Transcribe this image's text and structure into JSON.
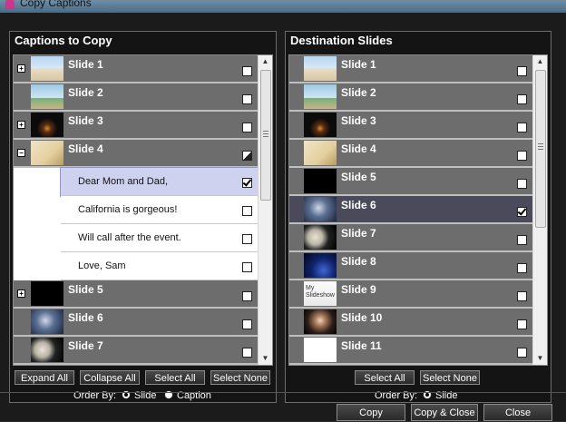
{
  "window": {
    "title": "Copy Captions"
  },
  "left": {
    "title": "Captions to Copy",
    "rows": [
      {
        "type": "slide",
        "label": "Slide 1",
        "thumb": "beach",
        "expander": "+",
        "checkbox": "unchecked"
      },
      {
        "type": "slide",
        "label": "Slide 2",
        "thumb": "palm",
        "expander": "",
        "checkbox": "unchecked"
      },
      {
        "type": "slide",
        "label": "Slide 3",
        "thumb": "night-road",
        "expander": "+",
        "checkbox": "unchecked"
      },
      {
        "type": "slide",
        "label": "Slide 4",
        "thumb": "letter",
        "expander": "−",
        "checkbox": "partial"
      },
      {
        "type": "caption",
        "label": "Dear Mom and Dad,",
        "checkbox": "checked",
        "selected": true
      },
      {
        "type": "caption",
        "label": "California is gorgeous!",
        "checkbox": "unchecked"
      },
      {
        "type": "caption",
        "label": "Will call after the event.",
        "checkbox": "unchecked"
      },
      {
        "type": "caption",
        "label": "Love, Sam",
        "checkbox": "unchecked"
      },
      {
        "type": "slide",
        "label": "Slide 5",
        "thumb": "black",
        "expander": "+",
        "checkbox": "unchecked"
      },
      {
        "type": "slide",
        "label": "Slide 6",
        "thumb": "blue-photo",
        "expander": "",
        "checkbox": "unchecked"
      },
      {
        "type": "slide",
        "label": "Slide 7",
        "thumb": "moon",
        "expander": "",
        "checkbox": "unchecked"
      }
    ],
    "buttons": {
      "expand_all": "Expand All",
      "collapse_all": "Collapse All",
      "select_all": "Select All",
      "select_none": "Select None"
    },
    "order": {
      "label": "Order By:",
      "options": [
        "Slide",
        "Caption"
      ],
      "selected": "Slide"
    }
  },
  "right": {
    "title": "Destination Slides",
    "rows": [
      {
        "type": "slide",
        "label": "Slide 1",
        "thumb": "beach",
        "checkbox": "unchecked"
      },
      {
        "type": "slide",
        "label": "Slide 2",
        "thumb": "palm",
        "checkbox": "unchecked"
      },
      {
        "type": "slide",
        "label": "Slide 3",
        "thumb": "night-road",
        "checkbox": "unchecked"
      },
      {
        "type": "slide",
        "label": "Slide 4",
        "thumb": "letter",
        "checkbox": "unchecked"
      },
      {
        "type": "slide",
        "label": "Slide 5",
        "thumb": "black",
        "checkbox": "unchecked"
      },
      {
        "type": "slide",
        "label": "Slide 6",
        "thumb": "blue-photo",
        "checkbox": "checked",
        "selected": true
      },
      {
        "type": "slide",
        "label": "Slide 7",
        "thumb": "moon",
        "checkbox": "unchecked"
      },
      {
        "type": "slide",
        "label": "Slide 8",
        "thumb": "blue-night",
        "checkbox": "unchecked"
      },
      {
        "type": "slide",
        "label": "Slide 9",
        "thumb": "myslideshow",
        "thumb_text": "My Slideshow",
        "checkbox": "unchecked"
      },
      {
        "type": "slide",
        "label": "Slide 10",
        "thumb": "person",
        "checkbox": "unchecked"
      },
      {
        "type": "slide",
        "label": "Slide 11",
        "thumb": "white",
        "checkbox": "unchecked"
      }
    ],
    "buttons": {
      "select_all": "Select All",
      "select_none": "Select None"
    },
    "order": {
      "label": "Order By:",
      "options": [
        "Slide"
      ],
      "selected": "Slide"
    }
  },
  "footer": {
    "copy": "Copy",
    "copy_close": "Copy & Close",
    "close": "Close"
  }
}
